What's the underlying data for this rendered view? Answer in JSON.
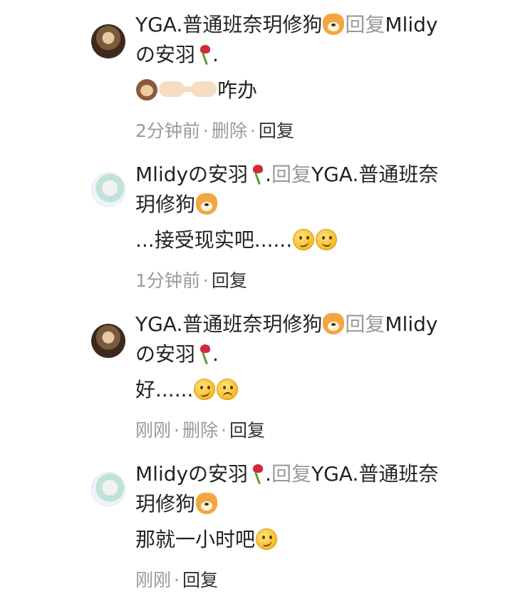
{
  "comments": [
    {
      "author": "YGA.普通班奈玥修狗",
      "reply_word": "回复",
      "target_line1": "Mlidy",
      "target_line2": "の安羽",
      "target_suffix": ".",
      "text": "咋办",
      "time": "2分钟前",
      "delete_label": "删除",
      "reply_label": "回复"
    },
    {
      "author": "Mlidyの安羽",
      "author_suffix": ".",
      "reply_word": "回复",
      "target_line1": "YGA.普通班奈",
      "target_line2": "玥修狗",
      "text": "...接受现实吧......",
      "time": "1分钟前",
      "reply_label": "回复"
    },
    {
      "author": "YGA.普通班奈玥修狗",
      "reply_word": "回复",
      "target_line1": "Mlidy",
      "target_line2": "の安羽",
      "target_suffix": ".",
      "text": "好......",
      "time": "刚刚",
      "delete_label": "删除",
      "reply_label": "回复"
    },
    {
      "author": "Mlidyの安羽",
      "author_suffix": ".",
      "reply_word": "回复",
      "target_line1": "YGA.普通班奈",
      "target_line2": "玥修狗",
      "text": "那就一小时吧",
      "time": "刚刚",
      "reply_label": "回复"
    }
  ],
  "icons": {
    "dog": "shiba-dog-emoji",
    "rose": "wilted-rose-emoji",
    "monkey": "see-no-evil-monkey-emoji",
    "point_right": "pointing-right-hand-emoji",
    "point_left": "pointing-left-hand-emoji",
    "smirk": "smirking-face-emoji",
    "smile": "slightly-smiling-face-emoji",
    "frown": "frowning-face-emoji"
  }
}
